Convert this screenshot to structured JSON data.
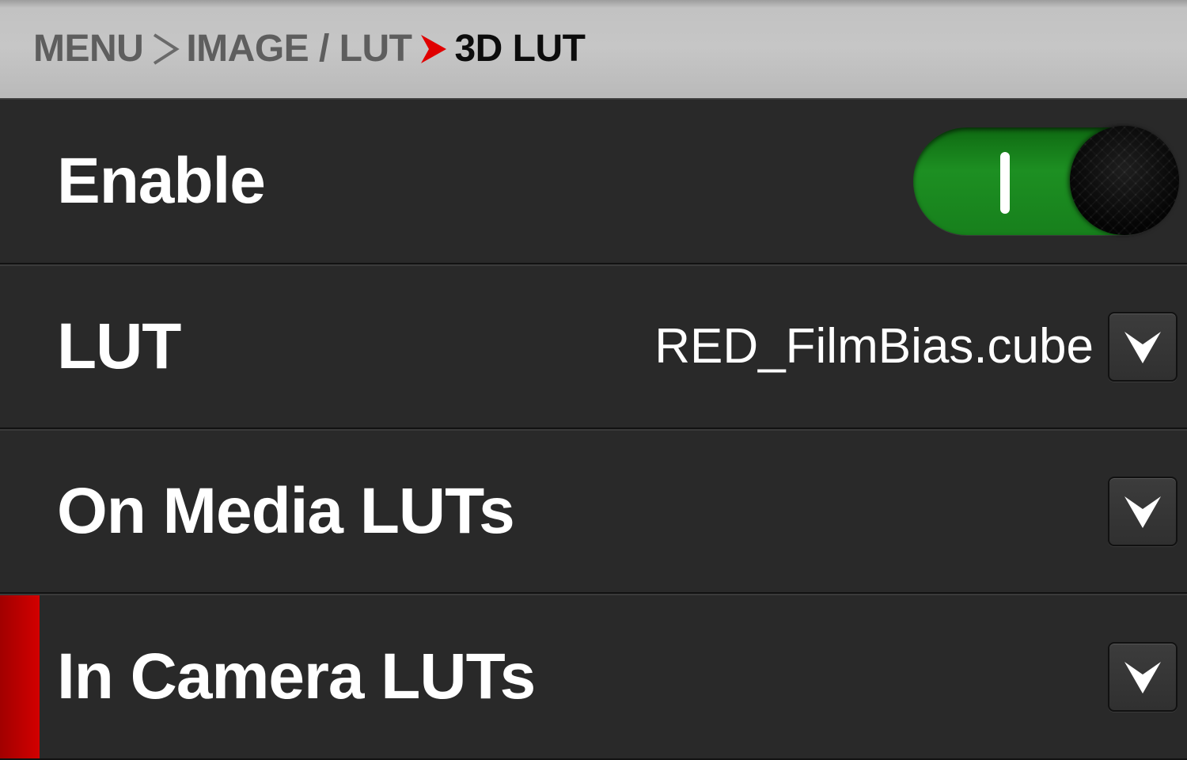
{
  "breadcrumb": {
    "items": [
      "MENU",
      "IMAGE / LUT",
      "3D LUT"
    ],
    "separator_icons": [
      "chevron-right-icon",
      "chevron-right-icon"
    ],
    "current_separator_color": "#e00000",
    "separator_color": "#6a6a6a"
  },
  "rows": {
    "enable": {
      "label": "Enable",
      "toggle_state": "on",
      "toggle_color": "#1d8f22"
    },
    "lut": {
      "label": "LUT",
      "value": "RED_FilmBias.cube",
      "icon": "chevron-down-icon"
    },
    "on_media": {
      "label": "On Media LUTs",
      "icon": "chevron-down-icon"
    },
    "in_camera": {
      "label": "In Camera LUTs",
      "icon": "chevron-down-icon",
      "selected": true,
      "selected_color": "#d30000"
    }
  }
}
